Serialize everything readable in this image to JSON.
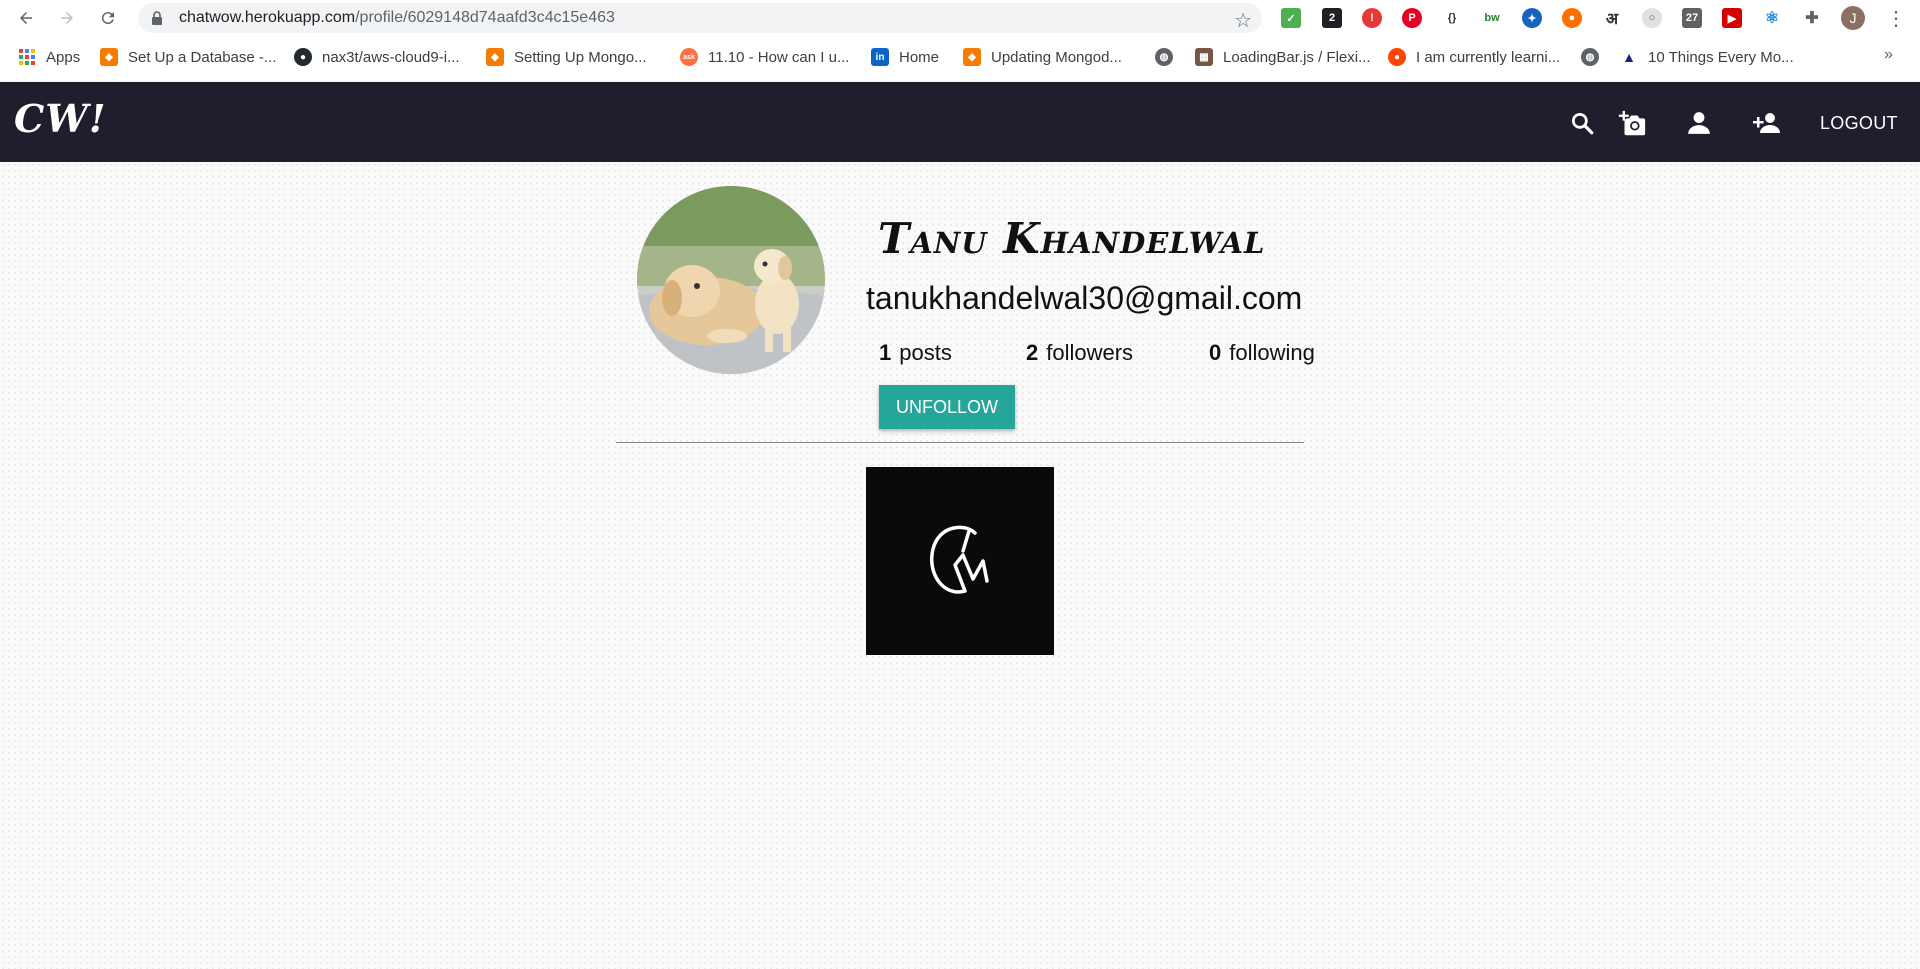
{
  "browser": {
    "url_host": "chatwow.herokuapp.com",
    "url_path": "/profile/6029148d74aafd3c4c15e463",
    "profile_initial": "J",
    "bookmarks": [
      {
        "label": "Apps",
        "icon": "apps-grid-icon"
      },
      {
        "label": "Set Up a Database -...",
        "icon": "box-icon"
      },
      {
        "label": "nax3t/aws-cloud9-i...",
        "icon": "github-icon"
      },
      {
        "label": "Setting Up Mongo...",
        "icon": "box-icon"
      },
      {
        "label": "11.10 - How can I u...",
        "icon": "ask-icon"
      },
      {
        "label": "Home",
        "icon": "linkedin-icon"
      },
      {
        "label": "Updating Mongod...",
        "icon": "box-icon"
      },
      {
        "label": "",
        "icon": "globe-icon"
      },
      {
        "label": "LoadingBar.js / Flexi...",
        "icon": "site-icon"
      },
      {
        "label": "I am currently learni...",
        "icon": "reddit-icon"
      },
      {
        "label": "",
        "icon": "globe-icon"
      },
      {
        "label": "10 Things Every Mo...",
        "icon": "triangle-icon"
      }
    ],
    "more_bookmarks": "»"
  },
  "app": {
    "brand": "CW!",
    "logout_label": "LOGOUT"
  },
  "profile": {
    "name": "Tanu Khandelwal",
    "email": "tanukhandelwal30@gmail.com",
    "posts_count": "1",
    "posts_label": "posts",
    "followers_count": "2",
    "followers_label": "followers",
    "following_count": "0",
    "following_label": "following",
    "unfollow_label": "UNFOLLOW"
  },
  "colors": {
    "header_bg": "#1e1e2c",
    "button": "#26a69a"
  }
}
